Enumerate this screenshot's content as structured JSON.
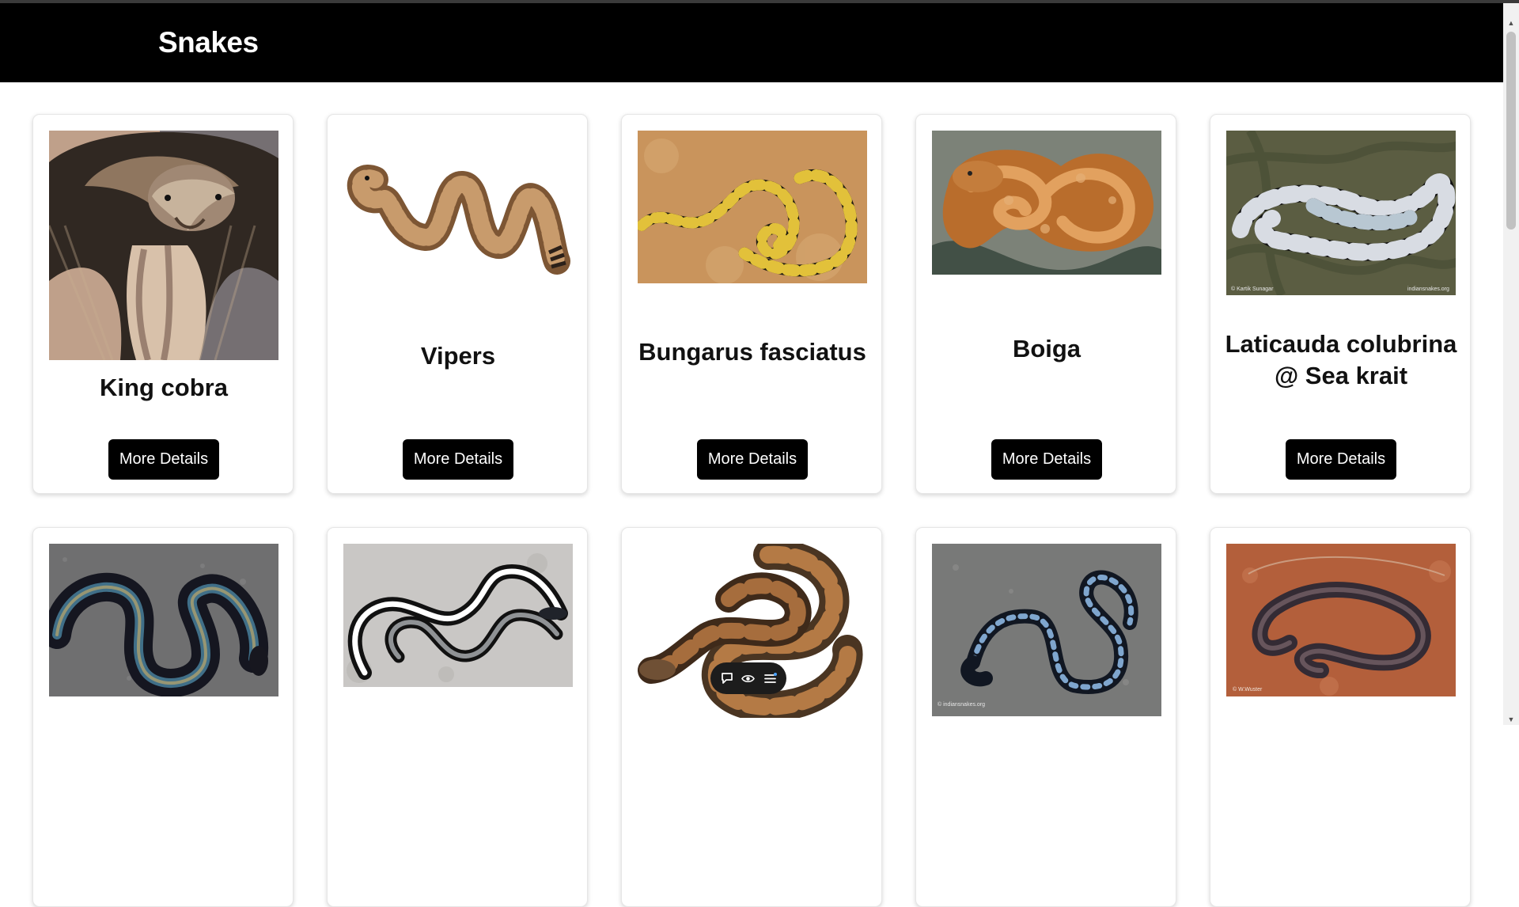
{
  "page": {
    "title": "Snakes",
    "colors": {
      "header": "#000000",
      "card_button": "#000000",
      "card_border": "#e6e6e6"
    }
  },
  "cards": [
    {
      "name": "King cobra",
      "button": "More Details",
      "image": "king-cobra-image"
    },
    {
      "name": "Vipers",
      "button": "More Details",
      "image": "viper-image"
    },
    {
      "name": "Bungarus fasciatus",
      "button": "More Details",
      "image": "banded-krait-image"
    },
    {
      "name": "Boiga",
      "button": "More Details",
      "image": "boiga-image"
    },
    {
      "name": "Laticauda colubrina @ Sea krait",
      "button": "More Details",
      "image": "sea-krait-image"
    },
    {
      "name": "",
      "button": "",
      "image": "iridescent-snake-image"
    },
    {
      "name": "",
      "button": "",
      "image": "striped-snake-image"
    },
    {
      "name": "",
      "button": "",
      "image": "ball-python-image"
    },
    {
      "name": "",
      "button": "",
      "image": "blue-krait-image"
    },
    {
      "name": "",
      "button": "",
      "image": "brown-snake-image"
    }
  ],
  "image_credits": {
    "sea_krait_left": "© Kartik Sunagar",
    "sea_krait_right": "indiansnakes.org",
    "blue_krait_left": "© indiansnakes.org",
    "brown_snake_left": "© W.Wuster"
  },
  "floating_toolbar": {
    "icons": [
      "chat-bubble-icon",
      "eye-icon",
      "menu-icon"
    ]
  }
}
